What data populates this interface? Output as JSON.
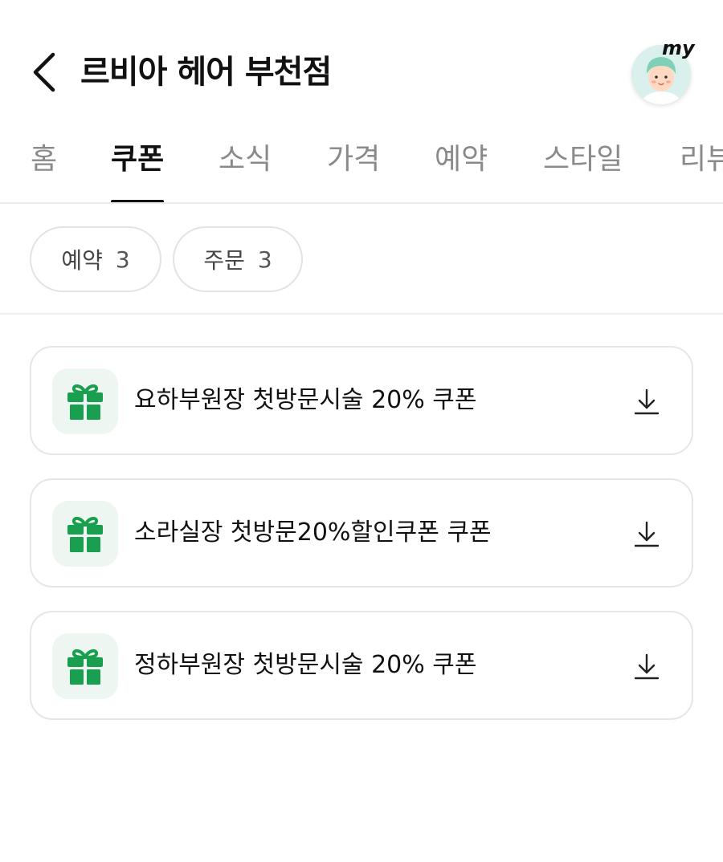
{
  "header": {
    "back_icon": "chevron-left-icon",
    "title": "르비아 헤어 부천점",
    "profile_badge": "my"
  },
  "tabs": [
    {
      "label": "홈",
      "active": false
    },
    {
      "label": "쿠폰",
      "active": true
    },
    {
      "label": "소식",
      "active": false
    },
    {
      "label": "가격",
      "active": false
    },
    {
      "label": "예약",
      "active": false
    },
    {
      "label": "스타일",
      "active": false
    },
    {
      "label": "리뷰",
      "active": false
    }
  ],
  "filters": [
    {
      "label": "예약",
      "count": "3"
    },
    {
      "label": "주문",
      "count": "3"
    }
  ],
  "coupons": [
    {
      "label": "요하부원장 첫방문시술 20% 쿠폰",
      "icon": "gift-icon",
      "action_icon": "download-icon"
    },
    {
      "label": "소라실장 첫방문20%할인쿠폰 쿠폰",
      "icon": "gift-icon",
      "action_icon": "download-icon"
    },
    {
      "label": "정하부원장 첫방문시술 20% 쿠폰",
      "icon": "gift-icon",
      "action_icon": "download-icon"
    }
  ],
  "colors": {
    "accent_green": "#1a9e4f",
    "gift_bg": "#eef6f2",
    "text_primary": "#111111",
    "text_inactive": "#8a8a8a"
  }
}
